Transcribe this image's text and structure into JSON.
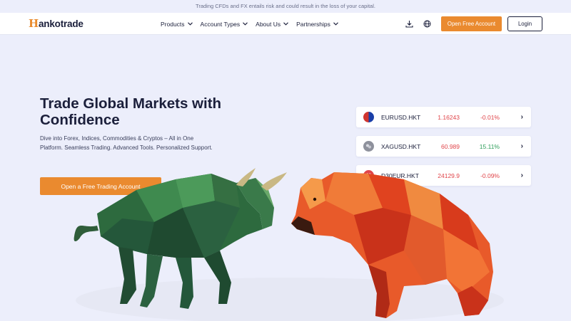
{
  "risk_warning": "Trading CFDs and FX entails risk and could result in the loss of your capital.",
  "brand": {
    "logo_letter": "H",
    "logo_rest": "ankotrade"
  },
  "nav": {
    "items": [
      {
        "label": "Products"
      },
      {
        "label": "Account Types"
      },
      {
        "label": "About Us"
      },
      {
        "label": "Partnerships"
      }
    ],
    "open_account_label": "Open Free Account",
    "login_label": "Login"
  },
  "hero": {
    "title": "Trade Global Markets with Confidence",
    "subtitle": "Dive into Forex, Indices, Commodities & Cryptos – All in One Platform. Seamless Trading. Advanced Tools. Personalized Support.",
    "cta_label": "Open a Free Trading Account"
  },
  "quotes": [
    {
      "symbol": "EURUSD.HKT",
      "price": "1.16243",
      "change": "-0.01%",
      "change_color": "#e0454a",
      "icon": "eu-us-flag-icon"
    },
    {
      "symbol": "XAGUSD.HKT",
      "price": "60.989",
      "change": "15.11%",
      "change_color": "#2e9e5a",
      "icon": "silver-icon"
    },
    {
      "symbol": "D30EUR.HKT",
      "price": "24129.9",
      "change": "-0.09%",
      "change_color": "#e0454a",
      "icon": "index-icon",
      "icon_text": "30"
    }
  ],
  "colors": {
    "accent": "#ea8a2f",
    "background": "#eceefb",
    "text": "#1b1f3b",
    "negative": "#e0454a",
    "positive": "#2e9e5a"
  }
}
